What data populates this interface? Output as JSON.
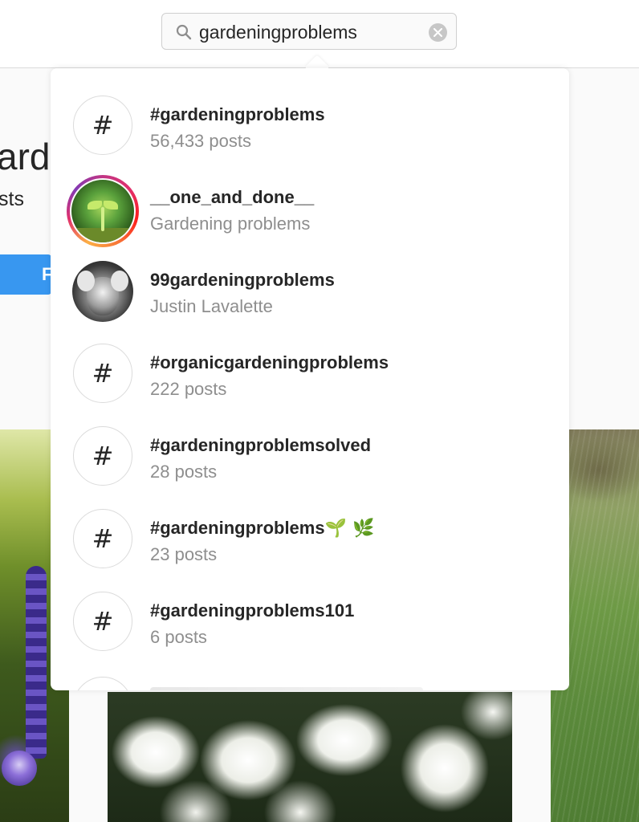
{
  "search": {
    "value": "gardeningproblems",
    "icon": "search-icon",
    "clear_icon": "clear-icon"
  },
  "background_page": {
    "title_fragment": "arde",
    "subtitle_fragment": "sts",
    "button_fragment": "F"
  },
  "results": [
    {
      "type": "hashtag",
      "icon": "hashtag-icon",
      "badge": "#",
      "title": "#gardeningproblems",
      "subtitle": "56,433 posts"
    },
    {
      "type": "user",
      "icon": "avatar-sprout",
      "title": "__one_and_done__",
      "subtitle": "Gardening problems"
    },
    {
      "type": "user",
      "icon": "avatar-photo",
      "title": "99gardeningproblems",
      "subtitle": "Justin Lavalette"
    },
    {
      "type": "hashtag",
      "icon": "hashtag-icon",
      "badge": "#",
      "title": "#organicgardeningproblems",
      "subtitle": "222 posts"
    },
    {
      "type": "hashtag",
      "icon": "hashtag-icon",
      "badge": "#",
      "title": "#gardeningproblemsolved",
      "subtitle": "28 posts"
    },
    {
      "type": "hashtag",
      "icon": "hashtag-icon",
      "badge": "#",
      "title": "#gardeningproblems",
      "title_emoji": "🌱 🌿",
      "subtitle": "23 posts"
    },
    {
      "type": "hashtag",
      "icon": "hashtag-icon",
      "badge": "#",
      "title": "#gardeningproblems101",
      "subtitle": "6 posts"
    }
  ],
  "colors": {
    "accent": "#3897f0",
    "text_primary": "#262626",
    "text_secondary": "#8e8e8e",
    "border": "#dbdbdb"
  }
}
